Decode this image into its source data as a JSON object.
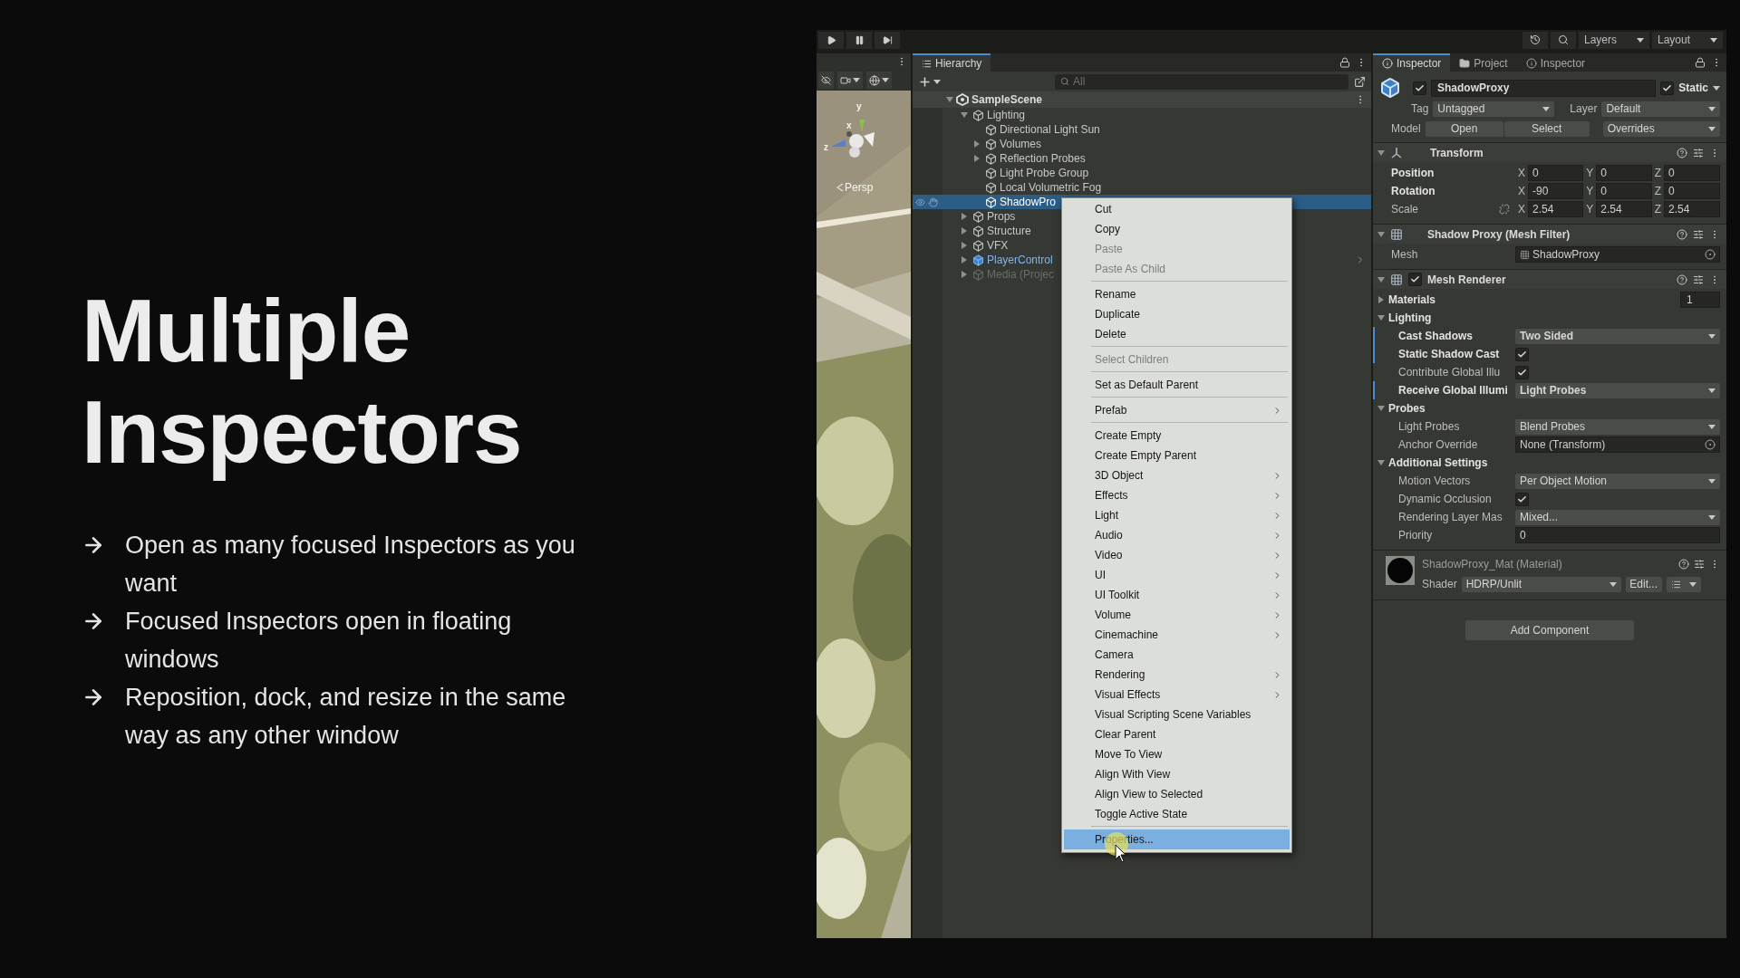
{
  "slide": {
    "title": "Multiple Inspectors",
    "bullets": [
      "Open as many focused Inspectors as you want",
      "Focused Inspectors open in floating windows",
      "Reposition, dock, and resize in the same way as any other window"
    ]
  },
  "toolbar": {
    "playback": [
      {
        "kind": "play"
      },
      {
        "kind": "pause"
      },
      {
        "kind": "step"
      }
    ],
    "dropdowns": [
      "Layers",
      "Layout"
    ]
  },
  "scene_view": {
    "gizmo_axes": [
      "y",
      "x",
      "z"
    ],
    "projection": "Persp"
  },
  "hierarchy": {
    "tab": "Hierarchy",
    "search": {
      "placeholder": "All"
    },
    "scene": "SampleScene",
    "items": [
      {
        "label": "Lighting",
        "kind": "object",
        "expanded": true,
        "selected": false,
        "inactive": false,
        "children": [
          {
            "label": "Directional Light Sun",
            "kind": "object",
            "selected": false,
            "inactive": false
          },
          {
            "label": "Volumes",
            "kind": "object",
            "expanded": false,
            "selected": false,
            "inactive": false
          },
          {
            "label": "Reflection Probes",
            "kind": "object",
            "expanded": false,
            "selected": false,
            "inactive": false
          },
          {
            "label": "Light Probe Group",
            "kind": "object",
            "selected": false,
            "inactive": false
          },
          {
            "label": "Local Volumetric Fog",
            "kind": "object",
            "selected": false,
            "inactive": false
          },
          {
            "label": "ShadowPro",
            "kind": "object",
            "selected": true,
            "inactive": false
          }
        ]
      },
      {
        "label": "Props",
        "kind": "object",
        "expanded": false,
        "selected": false,
        "inactive": false
      },
      {
        "label": "Structure",
        "kind": "object",
        "expanded": false,
        "selected": false,
        "inactive": false
      },
      {
        "label": "VFX",
        "kind": "object",
        "expanded": false,
        "selected": false,
        "inactive": false
      },
      {
        "label": "PlayerControl",
        "kind": "prefab",
        "expanded": false,
        "selected": false,
        "inactive": false
      },
      {
        "label": "Media (Projec",
        "kind": "object",
        "expanded": false,
        "selected": false,
        "inactive": true
      }
    ]
  },
  "context_menu": {
    "groups": [
      [
        {
          "label": "Cut",
          "disabled": false,
          "submenu": false,
          "selected": false
        },
        {
          "label": "Copy",
          "disabled": false,
          "submenu": false,
          "selected": false
        },
        {
          "label": "Paste",
          "disabled": true,
          "submenu": false,
          "selected": false
        },
        {
          "label": "Paste As Child",
          "disabled": true,
          "submenu": false,
          "selected": false
        }
      ],
      [
        {
          "label": "Rename",
          "disabled": false,
          "submenu": false,
          "selected": false
        },
        {
          "label": "Duplicate",
          "disabled": false,
          "submenu": false,
          "selected": false
        },
        {
          "label": "Delete",
          "disabled": false,
          "submenu": false,
          "selected": false
        }
      ],
      [
        {
          "label": "Select Children",
          "disabled": true,
          "submenu": false,
          "selected": false
        }
      ],
      [
        {
          "label": "Set as Default Parent",
          "disabled": false,
          "submenu": false,
          "selected": false
        }
      ],
      [
        {
          "label": "Prefab",
          "disabled": false,
          "submenu": true,
          "selected": false
        }
      ],
      [
        {
          "label": "Create Empty",
          "disabled": false,
          "submenu": false,
          "selected": false
        },
        {
          "label": "Create Empty Parent",
          "disabled": false,
          "submenu": false,
          "selected": false
        },
        {
          "label": "3D Object",
          "disabled": false,
          "submenu": true,
          "selected": false
        },
        {
          "label": "Effects",
          "disabled": false,
          "submenu": true,
          "selected": false
        },
        {
          "label": "Light",
          "disabled": false,
          "submenu": true,
          "selected": false
        },
        {
          "label": "Audio",
          "disabled": false,
          "submenu": true,
          "selected": false
        },
        {
          "label": "Video",
          "disabled": false,
          "submenu": true,
          "selected": false
        },
        {
          "label": "UI",
          "disabled": false,
          "submenu": true,
          "selected": false
        },
        {
          "label": "UI Toolkit",
          "disabled": false,
          "submenu": true,
          "selected": false
        },
        {
          "label": "Volume",
          "disabled": false,
          "submenu": true,
          "selected": false
        },
        {
          "label": "Cinemachine",
          "disabled": false,
          "submenu": true,
          "selected": false
        },
        {
          "label": "Camera",
          "disabled": false,
          "submenu": false,
          "selected": false
        },
        {
          "label": "Rendering",
          "disabled": false,
          "submenu": true,
          "selected": false
        },
        {
          "label": "Visual Effects",
          "disabled": false,
          "submenu": true,
          "selected": false
        },
        {
          "label": "Visual Scripting Scene Variables",
          "disabled": false,
          "submenu": false,
          "selected": false
        },
        {
          "label": "Clear Parent",
          "disabled": false,
          "submenu": false,
          "selected": false
        },
        {
          "label": "Move To View",
          "disabled": false,
          "submenu": false,
          "selected": false
        },
        {
          "label": "Align With View",
          "disabled": false,
          "submenu": false,
          "selected": false
        },
        {
          "label": "Align View to Selected",
          "disabled": false,
          "submenu": false,
          "selected": false
        },
        {
          "label": "Toggle Active State",
          "disabled": false,
          "submenu": false,
          "selected": false
        }
      ],
      [
        {
          "label": "Properties...",
          "disabled": false,
          "submenu": false,
          "selected": true
        }
      ]
    ]
  },
  "inspector": {
    "tabs": [
      {
        "label": "Inspector",
        "kind": "inspector",
        "selected": true
      },
      {
        "label": "Project",
        "kind": "project",
        "selected": false
      },
      {
        "label": "Inspector",
        "kind": "inspector",
        "selected": false
      }
    ],
    "object": {
      "active": true,
      "name": "ShadowProxy",
      "static": true,
      "static_label": "Static",
      "tag_label": "Tag",
      "tag": "Untagged",
      "layer_label": "Layer",
      "layer": "Default",
      "model_label": "Model",
      "model_buttons": [
        "Open",
        "Select"
      ],
      "overrides": "Overrides"
    },
    "components": [
      {
        "kind": "transform",
        "title": "Transform",
        "rows": [
          {
            "label": "Position",
            "overridden": true,
            "values": [
              {
                "axis": "X",
                "value": "0"
              },
              {
                "axis": "Y",
                "value": "0"
              },
              {
                "axis": "Z",
                "value": "0"
              }
            ]
          },
          {
            "label": "Rotation",
            "overridden": true,
            "values": [
              {
                "axis": "X",
                "value": "-90"
              },
              {
                "axis": "Y",
                "value": "0"
              },
              {
                "axis": "Z",
                "value": "0"
              }
            ]
          },
          {
            "label": "Scale",
            "overridden": false,
            "constrained": false,
            "values": [
              {
                "axis": "X",
                "value": "2.54"
              },
              {
                "axis": "Y",
                "value": "2.54"
              },
              {
                "axis": "Z",
                "value": "2.54"
              }
            ]
          }
        ]
      },
      {
        "kind": "mesh_filter",
        "title": "Shadow Proxy (Mesh Filter)",
        "fields": [
          {
            "kind": "asset",
            "label": "Mesh",
            "value": "ShadowProxy",
            "overridden": false
          }
        ]
      },
      {
        "kind": "mesh_renderer",
        "title": "Mesh Renderer",
        "enabled": true,
        "fields": [
          {
            "kind": "foldout",
            "label": "Materials",
            "expanded": false,
            "value": "1"
          },
          {
            "kind": "section",
            "label": "Lighting",
            "expanded": true,
            "fields": [
              {
                "kind": "dropdown",
                "label": "Cast Shadows",
                "value": "Two Sided",
                "overridden": true
              },
              {
                "kind": "toggle",
                "label": "Static Shadow Cast",
                "checked": true,
                "overridden": true
              },
              {
                "kind": "toggle",
                "label": "Contribute Global Illu",
                "checked": true,
                "overridden": false
              },
              {
                "kind": "dropdown",
                "label": "Receive Global Illumi",
                "value": "Light Probes",
                "overridden": true
              }
            ]
          },
          {
            "kind": "section",
            "label": "Probes",
            "expanded": true,
            "fields": [
              {
                "kind": "dropdown",
                "label": "Light Probes",
                "value": "Blend Probes",
                "overridden": false
              },
              {
                "kind": "object",
                "label": "Anchor Override",
                "value": "None (Transform)",
                "overridden": false
              }
            ]
          },
          {
            "kind": "section",
            "label": "Additional Settings",
            "expanded": true,
            "fields": [
              {
                "kind": "dropdown",
                "label": "Motion Vectors",
                "value": "Per Object Motion",
                "overridden": false
              },
              {
                "kind": "toggle",
                "label": "Dynamic Occlusion",
                "checked": true,
                "overridden": false
              },
              {
                "kind": "dropdown",
                "label": "Rendering Layer Mas",
                "value": "Mixed...",
                "overridden": false
              },
              {
                "kind": "text",
                "label": "Priority",
                "value": "0",
                "overridden": false
              }
            ]
          }
        ]
      },
      {
        "kind": "material",
        "title": "ShadowProxy_Mat",
        "subtitle": "(Material)",
        "shader_label": "Shader",
        "shader": "HDRP/Unlit",
        "edit": "Edit..."
      }
    ],
    "add_component": "Add Component"
  }
}
